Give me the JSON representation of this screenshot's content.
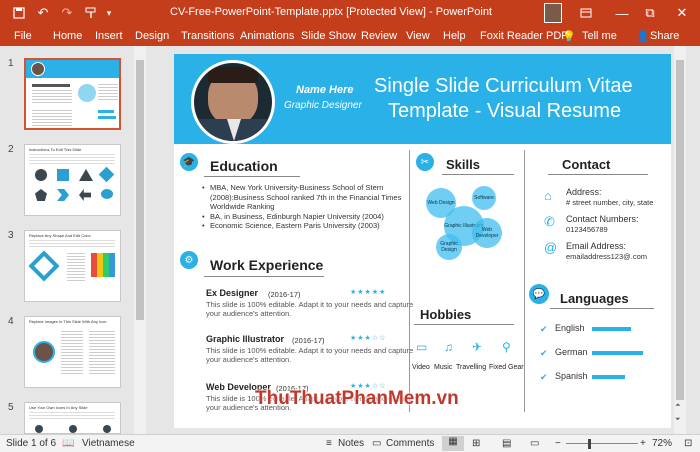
{
  "window": {
    "title": "CV-Free-PowerPoint-Template.pptx [Protected View] - PowerPoint"
  },
  "quick_access": {
    "save_icon": "save-icon",
    "undo_icon": "undo-icon",
    "redo_icon": "redo-icon",
    "format_painter_icon": "format-painter-icon",
    "customize_icon": "customize-icon"
  },
  "title_controls": {
    "minimize": "—",
    "maximize": "☐",
    "close": "✕",
    "restore": "⧉"
  },
  "ribbon": {
    "tabs": [
      "File",
      "Home",
      "Insert",
      "Design",
      "Transitions",
      "Animations",
      "Slide Show",
      "Review",
      "View",
      "Help",
      "Foxit Reader PDF"
    ],
    "tell_me": "Tell me",
    "share": "Share"
  },
  "thumbnails": [
    {
      "num": "1"
    },
    {
      "num": "2",
      "caption": "Instructions To Edit This Slide"
    },
    {
      "num": "3",
      "caption": "Replace Any Shape And Edit Color"
    },
    {
      "num": "4",
      "caption": "Replace Images In This Slide With Any Icon"
    },
    {
      "num": "5",
      "caption": "Use Your Own Icons In Any Slide"
    }
  ],
  "slide": {
    "name": "Name Here",
    "role": "Graphic Designer",
    "title_line1": "Single Slide Curriculum Vitae",
    "title_line2": "Template - Visual Resume",
    "education": {
      "title": "Education",
      "items": [
        "MBA, New York University-Business School of Stern (2008):Business School ranked 7th in the Financial Times Worldwide Ranking",
        "BA, in Business, Edinburgh Napier University (2004)",
        "Economic Science, Eastern Paris University (2003)"
      ]
    },
    "work": {
      "title": "Work Experience",
      "jobs": [
        {
          "title": "Ex Designer",
          "years": "(2016-17)",
          "desc1": "This slide is 100% editable. Adapt it to your needs and capture",
          "desc2": "your audience's attention.",
          "stars": "★★★★★"
        },
        {
          "title": "Graphic Illustrator",
          "years": "(2016-17)",
          "desc1": "This slide is 100% editable. Adapt it to your needs and capture",
          "desc2": "your audience's attention.",
          "stars": "★★★☆☆"
        },
        {
          "title": "Web Developer",
          "years": "(2016-17)",
          "desc1": "This slide is 100% editable. Adapt it to your needs and capture",
          "desc2": "your audience's attention.",
          "stars": "★★★☆☆"
        }
      ]
    },
    "skills": {
      "title": "Skills",
      "bubbles": [
        "Web Design",
        "Software",
        "Graphic Illustrator",
        "Web Developer",
        "Graphic Design"
      ]
    },
    "hobbies": {
      "title": "Hobbies",
      "items": [
        "Video",
        "Music",
        "Travelling",
        "Fixed Gear"
      ]
    },
    "contact": {
      "title": "Contact",
      "address_label": "Address:",
      "address_value": "# street number, city, state",
      "phone_label": "Contact Numbers:",
      "phone_value": "0123456789",
      "email_label": "Email Address:",
      "email_value": "emailaddress123@.com"
    },
    "languages": {
      "title": "Languages",
      "items": [
        {
          "name": "English",
          "level": 0.65
        },
        {
          "name": "German",
          "level": 0.85
        },
        {
          "name": "Spanish",
          "level": 0.55
        }
      ]
    }
  },
  "statusbar": {
    "slide_info": "Slide 1 of 6",
    "language": "Vietnamese",
    "notes": "Notes",
    "comments": "Comments",
    "zoom": "72%"
  },
  "watermark": "ThuThuatPhanMem.vn",
  "colors": {
    "accent": "#29b1e8",
    "titlebar": "#c43e1c"
  }
}
